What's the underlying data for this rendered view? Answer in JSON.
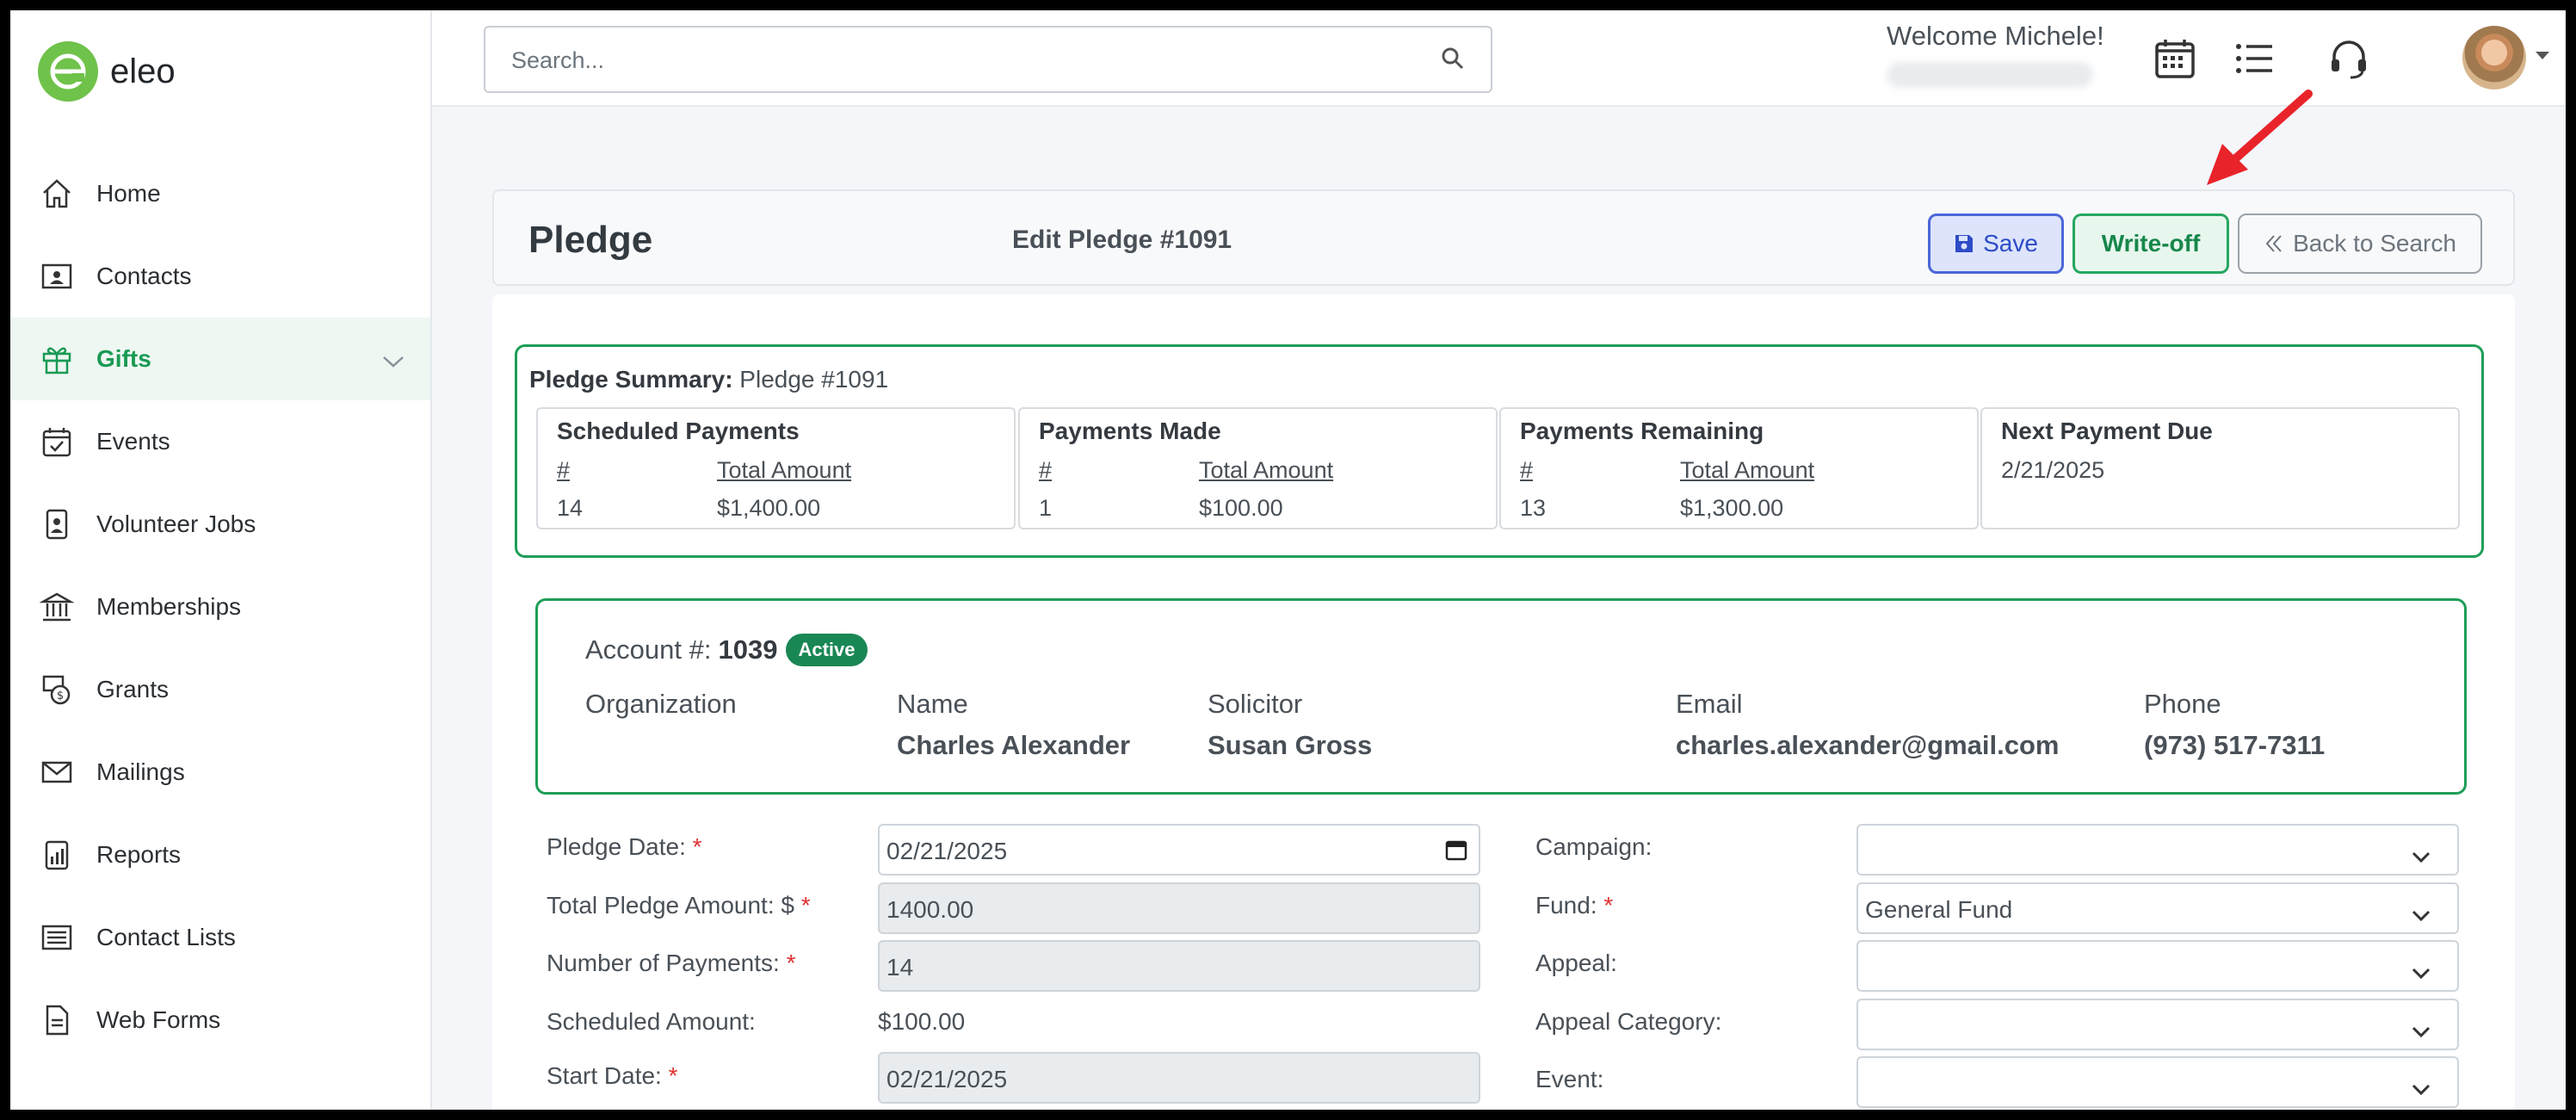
{
  "app": {
    "name": "eleo"
  },
  "sidebar": {
    "items": [
      {
        "label": "Home",
        "icon": "home-icon"
      },
      {
        "label": "Contacts",
        "icon": "contact-card-icon"
      },
      {
        "label": "Gifts",
        "icon": "gift-icon",
        "active": true
      },
      {
        "label": "Events",
        "icon": "calendar-check-icon"
      },
      {
        "label": "Volunteer Jobs",
        "icon": "id-badge-icon"
      },
      {
        "label": "Memberships",
        "icon": "bank-icon"
      },
      {
        "label": "Grants",
        "icon": "money-icon"
      },
      {
        "label": "Mailings",
        "icon": "envelope-icon"
      },
      {
        "label": "Reports",
        "icon": "report-icon"
      },
      {
        "label": "Contact Lists",
        "icon": "list-icon"
      },
      {
        "label": "Web Forms",
        "icon": "document-icon"
      }
    ]
  },
  "topbar": {
    "search_placeholder": "Search...",
    "welcome": "Welcome Michele!"
  },
  "page": {
    "title": "Pledge",
    "subtitle": "Edit Pledge #1091",
    "buttons": {
      "save": "Save",
      "writeoff": "Write-off",
      "back": "Back to Search"
    }
  },
  "summary": {
    "heading_bold": "Pledge Summary:",
    "heading_text": " Pledge #1091",
    "boxes": [
      {
        "title": "Scheduled Payments",
        "count_label": "#",
        "amount_label": "Total Amount",
        "count": "14",
        "amount": "$1,400.00"
      },
      {
        "title": "Payments Made",
        "count_label": "#",
        "amount_label": "Total Amount",
        "count": "1",
        "amount": "$100.00"
      },
      {
        "title": "Payments Remaining",
        "count_label": "#",
        "amount_label": "Total Amount",
        "count": "13",
        "amount": "$1,300.00"
      },
      {
        "title": "Next Payment Due",
        "date": "2/21/2025"
      }
    ]
  },
  "account": {
    "label": "Account #:",
    "number": "1039",
    "status": "Active",
    "organization_label": "Organization",
    "name_label": "Name",
    "name": "Charles Alexander",
    "solicitor_label": "Solicitor",
    "solicitor": "Susan Gross",
    "email_label": "Email",
    "email": "charles.alexander@gmail.com",
    "phone_label": "Phone",
    "phone": "(973) 517-7311"
  },
  "form": {
    "pledge_date_label": "Pledge Date:",
    "pledge_date": "02/21/2025",
    "total_label": "Total Pledge Amount: $",
    "total": "1400.00",
    "num_payments_label": "Number of Payments:",
    "num_payments": "14",
    "scheduled_label": "Scheduled Amount:",
    "scheduled": "$100.00",
    "start_date_label": "Start Date:",
    "start_date": "02/21/2025",
    "campaign_label": "Campaign:",
    "campaign": "",
    "fund_label": "Fund:",
    "fund": "General Fund",
    "appeal_label": "Appeal:",
    "appeal": "",
    "appeal_category_label": "Appeal Category:",
    "appeal_category": "",
    "event_label": "Event:",
    "event": "",
    "required_mark": "*"
  },
  "colors": {
    "accent_green": "#1e9e57",
    "save_blue": "#4b66d9",
    "arrow_red": "#e8242a"
  }
}
